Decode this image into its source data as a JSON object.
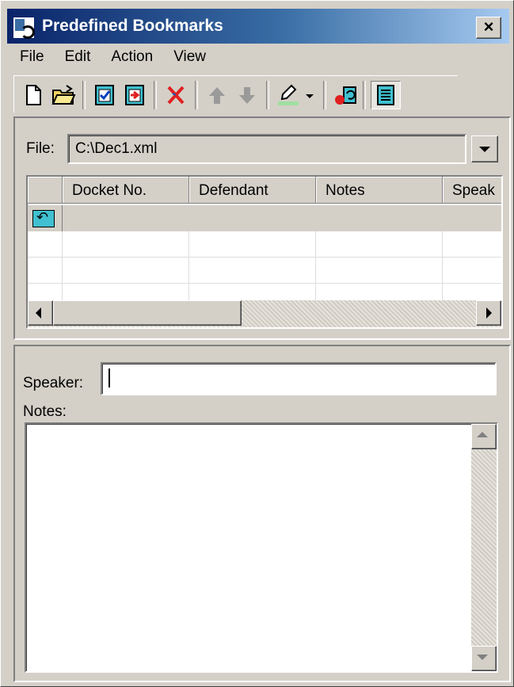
{
  "window": {
    "title": "Predefined Bookmarks",
    "close_label": "×"
  },
  "menu": {
    "items": [
      "File",
      "Edit",
      "Action",
      "View"
    ]
  },
  "toolbar": {
    "buttons": [
      {
        "name": "new-icon"
      },
      {
        "name": "open-folder-icon"
      },
      {
        "name": "check-document-icon"
      },
      {
        "name": "insert-document-icon"
      },
      {
        "name": "delete-icon"
      },
      {
        "name": "move-up-icon"
      },
      {
        "name": "move-down-icon"
      },
      {
        "name": "highlight-pen-icon"
      },
      {
        "name": "dropdown-arrow-icon"
      },
      {
        "name": "record-undo-icon"
      },
      {
        "name": "notes-view-icon"
      }
    ]
  },
  "file": {
    "label": "File:",
    "value": "C:\\Dec1.xml"
  },
  "grid": {
    "columns": [
      "Docket No.",
      "Defendant",
      "Notes",
      "Speak"
    ]
  },
  "details": {
    "speaker_label": "Speaker:",
    "speaker_value": "",
    "notes_label": "Notes:",
    "notes_value": ""
  },
  "colors": {
    "title_gradient_start": "#0a246a",
    "title_gradient_end": "#a6caf0",
    "face": "#d4d0c8"
  }
}
